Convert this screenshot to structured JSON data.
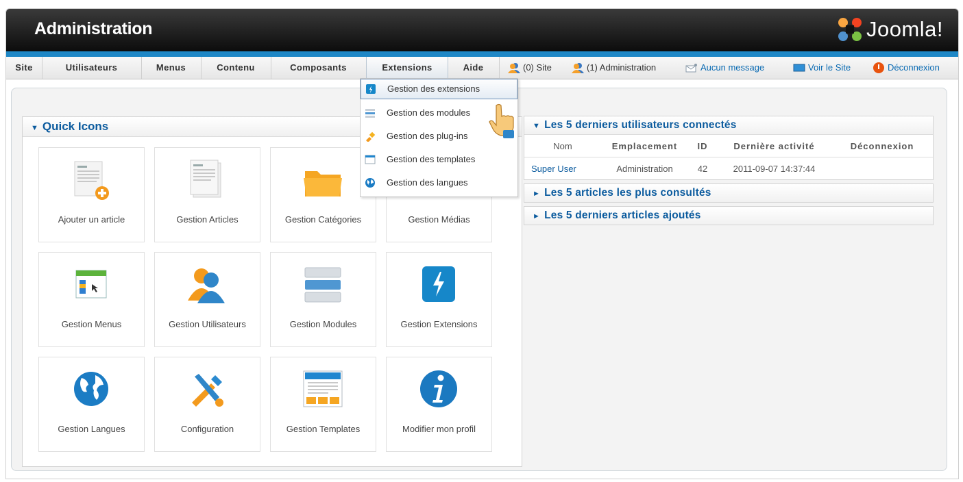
{
  "header": {
    "title": "Administration",
    "logo_text": "Joomla!"
  },
  "menu": {
    "items": [
      "Site",
      "Utilisateurs",
      "Menus",
      "Contenu",
      "Composants",
      "Extensions",
      "Aide"
    ],
    "active": "Extensions"
  },
  "status": {
    "site_users": "(0) Site",
    "admin_users": "(1) Administration",
    "messages": "Aucun message",
    "view_site": "Voir le Site",
    "logout": "Déconnexion"
  },
  "dropdown": {
    "items": [
      {
        "label": "Gestion des extensions",
        "icon": "extensions-icon",
        "highlighted": true
      },
      {
        "label": "Gestion des modules",
        "icon": "modules-icon"
      },
      {
        "label": "Gestion des plug-ins",
        "icon": "plugin-icon"
      },
      {
        "label": "Gestion des templates",
        "icon": "templates-icon"
      },
      {
        "label": "Gestion des langues",
        "icon": "languages-icon"
      }
    ]
  },
  "quick_icons": {
    "title": "Quick Icons",
    "tiles": [
      {
        "label": "Ajouter un article",
        "icon": "add-article-icon"
      },
      {
        "label": "Gestion Articles",
        "icon": "articles-icon"
      },
      {
        "label": "Gestion Catégories",
        "icon": "folder-icon"
      },
      {
        "label": "Gestion Médias",
        "icon": "media-icon"
      },
      {
        "label": "Gestion Menus",
        "icon": "menu-icon"
      },
      {
        "label": "Gestion Utilisateurs",
        "icon": "users-icon"
      },
      {
        "label": "Gestion Modules",
        "icon": "modules-icon"
      },
      {
        "label": "Gestion Extensions",
        "icon": "extensions-icon"
      },
      {
        "label": "Gestion Langues",
        "icon": "globe-icon"
      },
      {
        "label": "Configuration",
        "icon": "tools-icon"
      },
      {
        "label": "Gestion Templates",
        "icon": "template-icon"
      },
      {
        "label": "Modifier mon profil",
        "icon": "info-icon"
      }
    ]
  },
  "logged_users": {
    "title": "Les 5 derniers utilisateurs connectés",
    "columns": [
      "Nom",
      "Emplacement",
      "ID",
      "Dernière activité",
      "Déconnexion"
    ],
    "rows": [
      {
        "name": "Super User",
        "location": "Administration",
        "id": "42",
        "last_activity": "2011-09-07 14:37:44",
        "logout": ""
      }
    ]
  },
  "popular_articles": {
    "title": "Les 5 articles les plus consultés"
  },
  "latest_articles": {
    "title": "Les 5 derniers articles ajoutés"
  },
  "colors": {
    "accent": "#1e87c6",
    "link": "#0b5b9e",
    "header_bg": "#111111"
  }
}
